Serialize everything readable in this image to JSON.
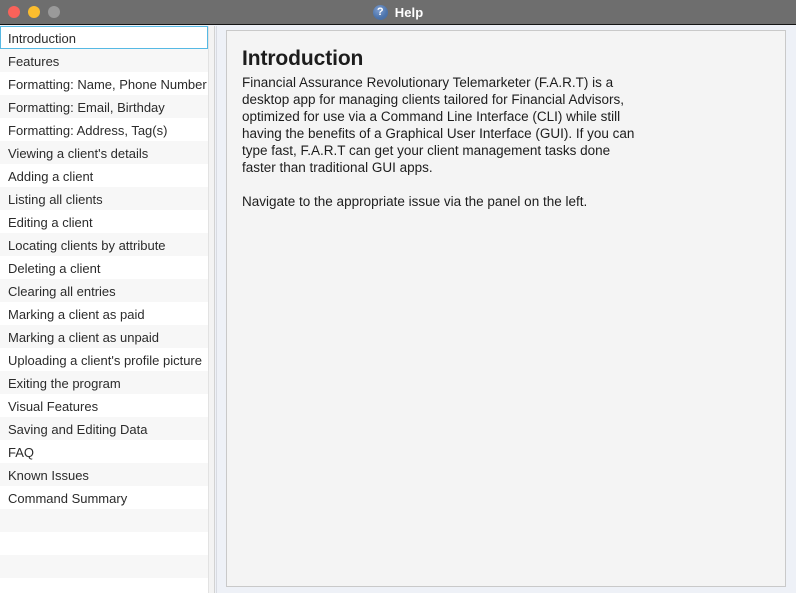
{
  "window": {
    "title": "Help",
    "title_icon": "help-question-icon",
    "traffic_lights": [
      {
        "name": "close",
        "color": "#f9625a"
      },
      {
        "name": "minimize",
        "color": "#fbbd2e"
      },
      {
        "name": "zoom",
        "color": "#9a9a9a"
      }
    ],
    "titlebar_color": "#6e6e6e",
    "background_color": "#eef1f7"
  },
  "sidebar": {
    "selected_index": 0,
    "selection_border_color": "#56b9e4",
    "items": [
      {
        "label": "Introduction"
      },
      {
        "label": "Features"
      },
      {
        "label": "Formatting: Name, Phone Number"
      },
      {
        "label": "Formatting: Email, Birthday"
      },
      {
        "label": "Formatting: Address, Tag(s)"
      },
      {
        "label": "Viewing a client's details"
      },
      {
        "label": "Adding a client"
      },
      {
        "label": "Listing all clients"
      },
      {
        "label": "Editing a client"
      },
      {
        "label": "Locating clients by attribute"
      },
      {
        "label": "Deleting a client"
      },
      {
        "label": "Clearing all entries"
      },
      {
        "label": "Marking a client as paid"
      },
      {
        "label": "Marking a client as unpaid"
      },
      {
        "label": "Uploading a client's profile picture"
      },
      {
        "label": "Exiting the program"
      },
      {
        "label": "Visual Features"
      },
      {
        "label": "Saving and Editing Data"
      },
      {
        "label": "FAQ"
      },
      {
        "label": "Known Issues"
      },
      {
        "label": "Command Summary"
      },
      {
        "label": ""
      },
      {
        "label": ""
      },
      {
        "label": ""
      },
      {
        "label": ""
      }
    ]
  },
  "document": {
    "heading": "Introduction",
    "paragraphs": [
      "Financial Assurance Revolutionary Telemarketer (F.A.R.T) is a desktop app for managing clients tailored for Financial Advisors, optimized for use via a Command Line Interface (CLI) while still having the benefits of a Graphical User Interface (GUI). If you can type fast, F.A.R.T can get your client management tasks done faster than traditional GUI apps.",
      "Navigate to the appropriate issue via the panel on the left."
    ]
  }
}
